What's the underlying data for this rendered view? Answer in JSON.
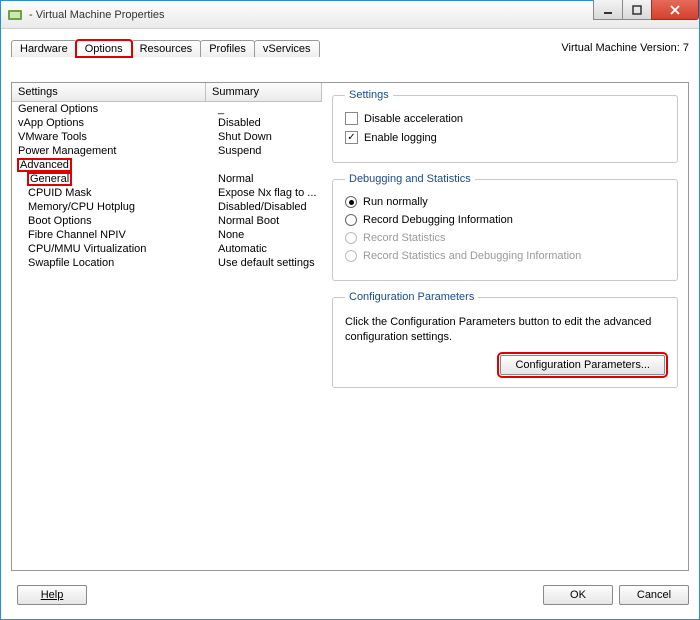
{
  "window": {
    "title": " - Virtual Machine Properties"
  },
  "version_label": "Virtual Machine Version: 7",
  "tabs": {
    "hardware": "Hardware",
    "options": "Options",
    "resources": "Resources",
    "profiles": "Profiles",
    "vservices": "vServices"
  },
  "list": {
    "header": {
      "settings": "Settings",
      "summary": "Summary"
    },
    "general_options": {
      "label": "General Options",
      "summary": "_"
    },
    "vapp_options": {
      "label": "vApp Options",
      "summary": "Disabled"
    },
    "vmware_tools": {
      "label": "VMware Tools",
      "summary": "Shut Down"
    },
    "power_mgmt": {
      "label": "Power Management",
      "summary": "Suspend"
    },
    "advanced": {
      "label": "Advanced",
      "summary": ""
    },
    "general": {
      "label": "General",
      "summary": "Normal"
    },
    "cpuid_mask": {
      "label": "CPUID Mask",
      "summary": "Expose Nx flag to ..."
    },
    "mem_cpu": {
      "label": "Memory/CPU Hotplug",
      "summary": "Disabled/Disabled"
    },
    "boot": {
      "label": "Boot Options",
      "summary": "Normal Boot"
    },
    "npiv": {
      "label": "Fibre Channel NPIV",
      "summary": "None"
    },
    "cpummu": {
      "label": "CPU/MMU Virtualization",
      "summary": "Automatic"
    },
    "swap": {
      "label": "Swapfile Location",
      "summary": "Use default settings"
    }
  },
  "settings_group": {
    "legend": "Settings",
    "disable_accel": "Disable acceleration",
    "enable_logging": "Enable logging"
  },
  "debug_group": {
    "legend": "Debugging and Statistics",
    "run_normally": "Run normally",
    "record_debug": "Record Debugging Information",
    "record_stats": "Record Statistics",
    "record_both": "Record Statistics and Debugging Information"
  },
  "config_group": {
    "legend": "Configuration Parameters",
    "help": "Click the Configuration Parameters button to edit the advanced configuration settings.",
    "button": "Configuration Parameters..."
  },
  "buttons": {
    "help": "Help",
    "ok": "OK",
    "cancel": "Cancel"
  }
}
